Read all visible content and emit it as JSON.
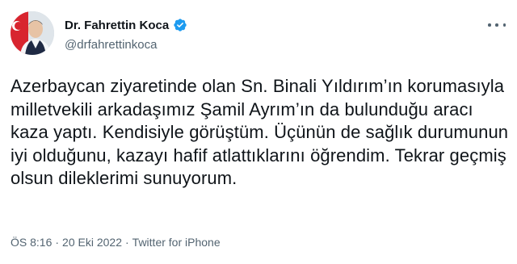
{
  "author": {
    "display_name": "Dr. Fahrettin Koca",
    "handle": "@drfahrettinkoca",
    "verified": true,
    "verified_color": "#1d9bf0"
  },
  "tweet": {
    "text": "Azerbaycan ziyaretinde olan Sn. Binali Yıldırım’ın korumasıyla milletvekili arkadaşımız Şamil Ayrım’ın da bulunduğu aracı kaza yaptı. Kendisiyle görüştüm. Üçünün de sağlık durumunun iyi olduğunu, kazayı hafif atlattıklarını öğrendim. Tekrar geçmiş olsun dileklerimi sunuyorum."
  },
  "meta": {
    "time": "ÖS 8:16",
    "separator": "·",
    "date": "20 Eki 2022",
    "source": "Twitter for iPhone"
  },
  "icons": {
    "more": "more-dots-icon",
    "verified": "verified-badge-icon"
  }
}
